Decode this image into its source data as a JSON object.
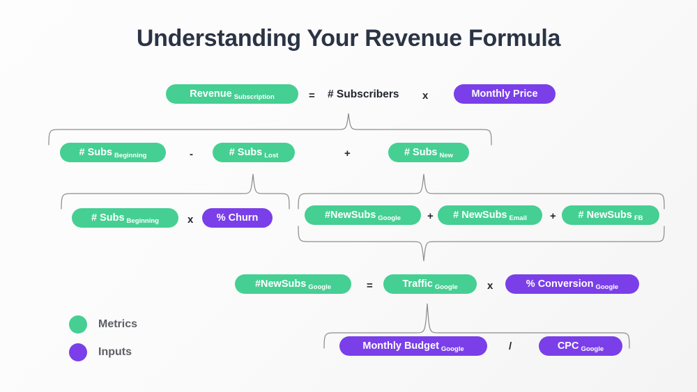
{
  "title": "Understanding Your Revenue Formula",
  "colors": {
    "metric": "#45cf93",
    "input": "#7a3fe8",
    "title_text": "#2b3445",
    "operator_text": "#23262e",
    "brace_stroke": "#8d8d8d",
    "background": "#fcfcfc"
  },
  "rows": {
    "row1": {
      "revenue": {
        "main": "Revenue",
        "sub": "Subscription",
        "kind": "metric"
      },
      "eq": "=",
      "subscribers": "# Subscribers",
      "times": "x",
      "price": {
        "main": "Monthly Price",
        "sub": "",
        "kind": "input"
      }
    },
    "row2": {
      "subs_beginning": {
        "main": "# Subs",
        "sub": "Beginning",
        "kind": "metric"
      },
      "minus": "-",
      "subs_lost": {
        "main": "# Subs",
        "sub": "Lost",
        "kind": "metric"
      },
      "plus": "+",
      "subs_new": {
        "main": "# Subs",
        "sub": "New",
        "kind": "metric"
      }
    },
    "row3": {
      "subs_beginning": {
        "main": "# Subs",
        "sub": "Beginning",
        "kind": "metric"
      },
      "times": "x",
      "churn": {
        "main": "% Churn",
        "sub": "",
        "kind": "input"
      },
      "newsubs_google": {
        "main": "#NewSubs",
        "sub": "Google",
        "kind": "metric"
      },
      "plus1": "+",
      "newsubs_email": {
        "main": "# NewSubs",
        "sub": "Email",
        "kind": "metric"
      },
      "plus2": "+",
      "newsubs_fb": {
        "main": "# NewSubs",
        "sub": "FB",
        "kind": "metric"
      }
    },
    "row4": {
      "newsubs_google": {
        "main": "#NewSubs",
        "sub": "Google",
        "kind": "metric"
      },
      "eq": "=",
      "traffic_google": {
        "main": "Traffic",
        "sub": "Google",
        "kind": "metric"
      },
      "times": "x",
      "conversion_google": {
        "main": "% Conversion",
        "sub": "Google",
        "kind": "input"
      }
    },
    "row5": {
      "monthly_budget": {
        "main": "Monthly Budget",
        "sub": "Google",
        "kind": "input"
      },
      "divide": "/",
      "cpc": {
        "main": "CPC",
        "sub": "Google",
        "kind": "input"
      }
    }
  },
  "legend": {
    "items": [
      {
        "label": "Metrics",
        "kind": "metric"
      },
      {
        "label": "Inputs",
        "kind": "input"
      }
    ]
  }
}
